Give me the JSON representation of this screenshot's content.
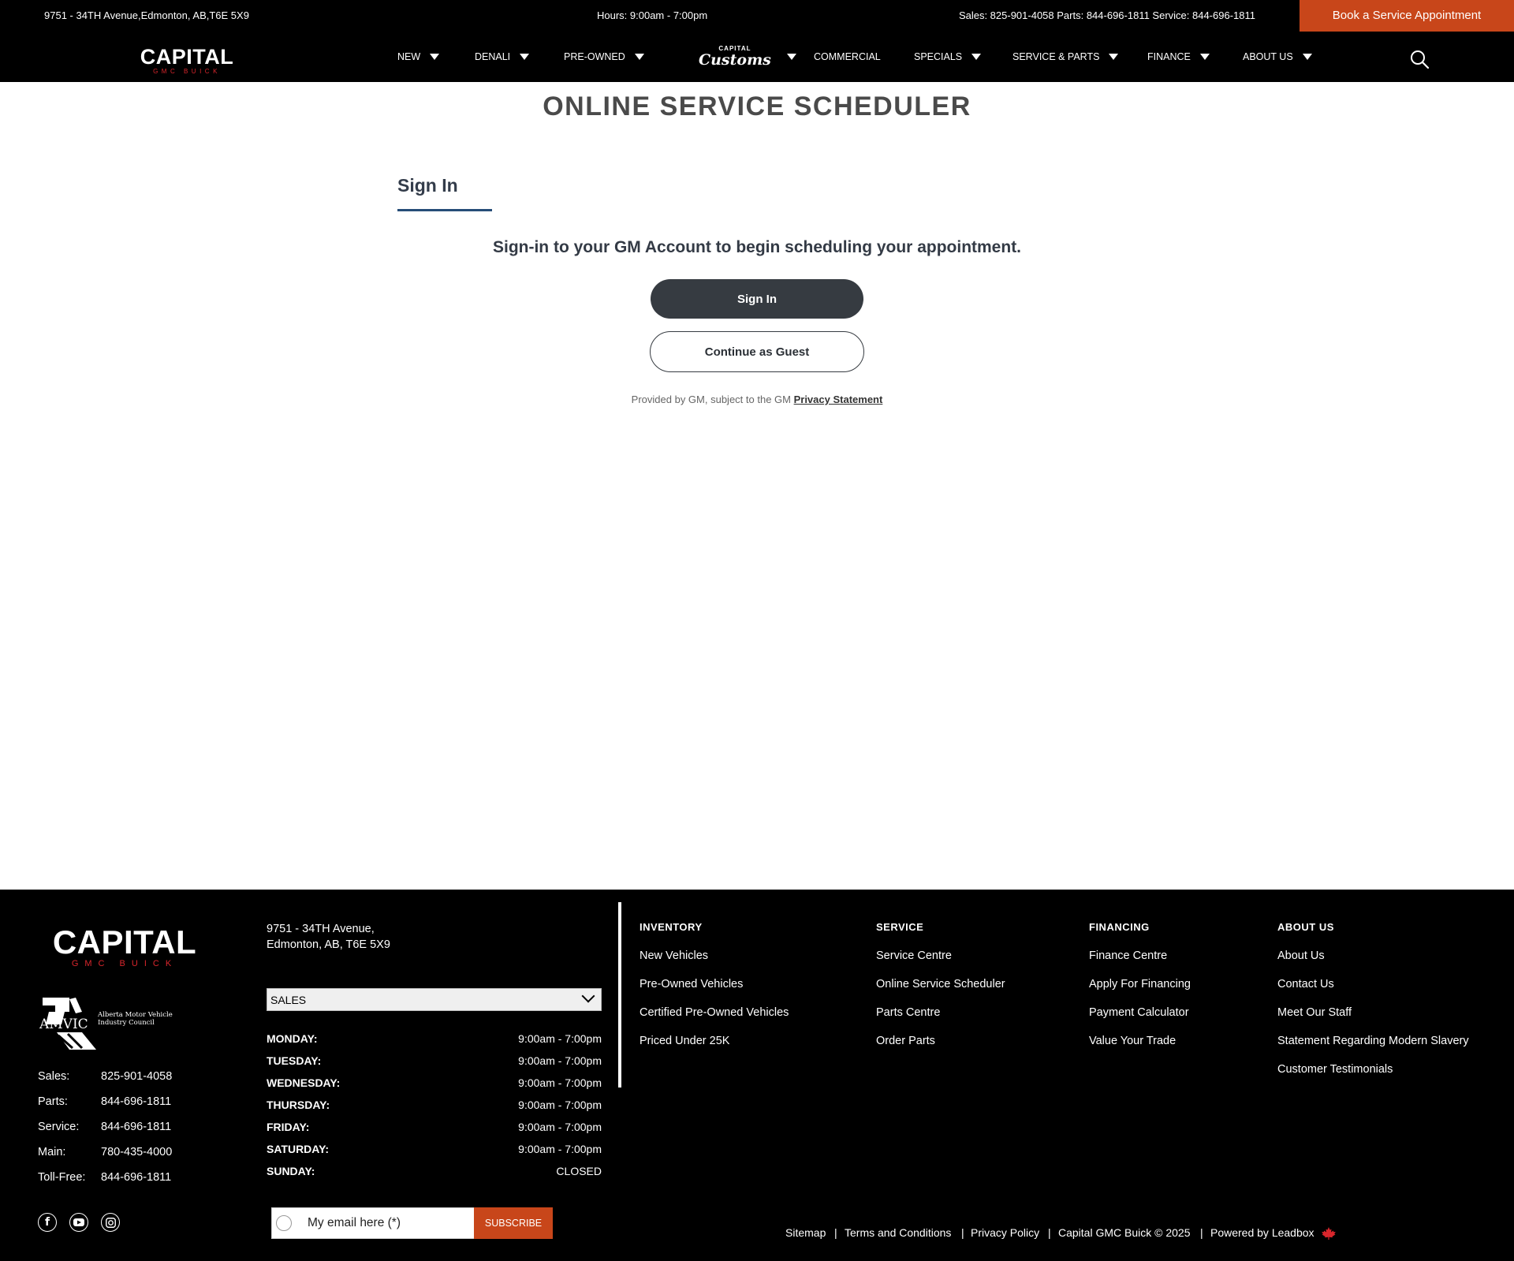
{
  "topbar": {
    "address": "9751 - 34TH Avenue,Edmonton, AB,T6E 5X9",
    "hours": "Hours: 9:00am - 7:00pm",
    "phones": "Sales: 825-901-4058 Parts: 844-696-1811 Service: 844-696-1811",
    "book_button": "Book a Service Appointment"
  },
  "brand": {
    "name": "CAPITAL",
    "sub": "GMC BUICK",
    "accent": "#c8461a",
    "red": "#d9262c"
  },
  "nav": {
    "items": {
      "new": "NEW",
      "denali": "DENALI",
      "preowned": "PRE-OWNED",
      "customs_top": "CAPITAL",
      "customs_main": "Customs",
      "commercial": "COMMERCIAL",
      "specials": "SPECIALS",
      "service": "SERVICE & PARTS",
      "finance": "FINANCE",
      "about": "ABOUT US"
    }
  },
  "main": {
    "title": "ONLINE SERVICE SCHEDULER",
    "tab": "Sign In",
    "lead": "Sign-in to your GM Account to begin scheduling your appointment.",
    "signin_button": "Sign In",
    "guest_button": "Continue as Guest",
    "provided_text": "Provided by GM, subject to the GM ",
    "privacy_link": "Privacy Statement"
  },
  "footer": {
    "amvic": {
      "logo": "AMVIC",
      "line1": "Alberta Motor Vehicle",
      "line2": "Industry Council"
    },
    "contacts": [
      {
        "label": "Sales:",
        "value": "825-901-4058"
      },
      {
        "label": "Parts:",
        "value": "844-696-1811"
      },
      {
        "label": "Service:",
        "value": "844-696-1811"
      },
      {
        "label": "Main:",
        "value": "780-435-4000"
      },
      {
        "label": "Toll-Free:",
        "value": "844-696-1811"
      }
    ],
    "social_icons": [
      "facebook-icon",
      "youtube-icon",
      "instagram-icon"
    ],
    "address_line1": "9751 - 34TH Avenue,",
    "address_line2": "Edmonton, AB, T6E 5X9",
    "department": "SALES",
    "hours": [
      {
        "day": "MONDAY:",
        "time": "9:00am - 7:00pm"
      },
      {
        "day": "TUESDAY:",
        "time": "9:00am - 7:00pm"
      },
      {
        "day": "WEDNESDAY:",
        "time": "9:00am - 7:00pm"
      },
      {
        "day": "THURSDAY:",
        "time": "9:00am - 7:00pm"
      },
      {
        "day": "FRIDAY:",
        "time": "9:00am - 7:00pm"
      },
      {
        "day": "SATURDAY:",
        "time": "9:00am - 7:00pm"
      },
      {
        "day": "SUNDAY:",
        "time": "CLOSED"
      }
    ],
    "columns": {
      "inventory": {
        "heading": "INVENTORY",
        "links": [
          "New Vehicles",
          "Pre-Owned Vehicles",
          "Certified Pre-Owned Vehicles",
          "Priced Under 25K"
        ]
      },
      "service": {
        "heading": "SERVICE",
        "links": [
          "Service Centre",
          "Online Service Scheduler",
          "Parts Centre",
          "Order Parts"
        ]
      },
      "financing": {
        "heading": "FINANCING",
        "links": [
          "Finance Centre",
          "Apply For Financing",
          "Payment Calculator",
          "Value Your Trade"
        ]
      },
      "about": {
        "heading": "ABOUT US",
        "links": [
          "About Us",
          "Contact Us",
          "Meet Our Staff",
          "Statement Regarding Modern Slavery",
          "Customer Testimonials"
        ]
      }
    },
    "email_placeholder": "My email here (*)",
    "subscribe": "SUBSCRIBE",
    "legal": {
      "sitemap": "Sitemap",
      "terms": "Terms and Conditions",
      "privacy": "Privacy Policy",
      "copyright": "Capital GMC Buick © 2025",
      "powered": "Powered by Leadbox"
    }
  }
}
